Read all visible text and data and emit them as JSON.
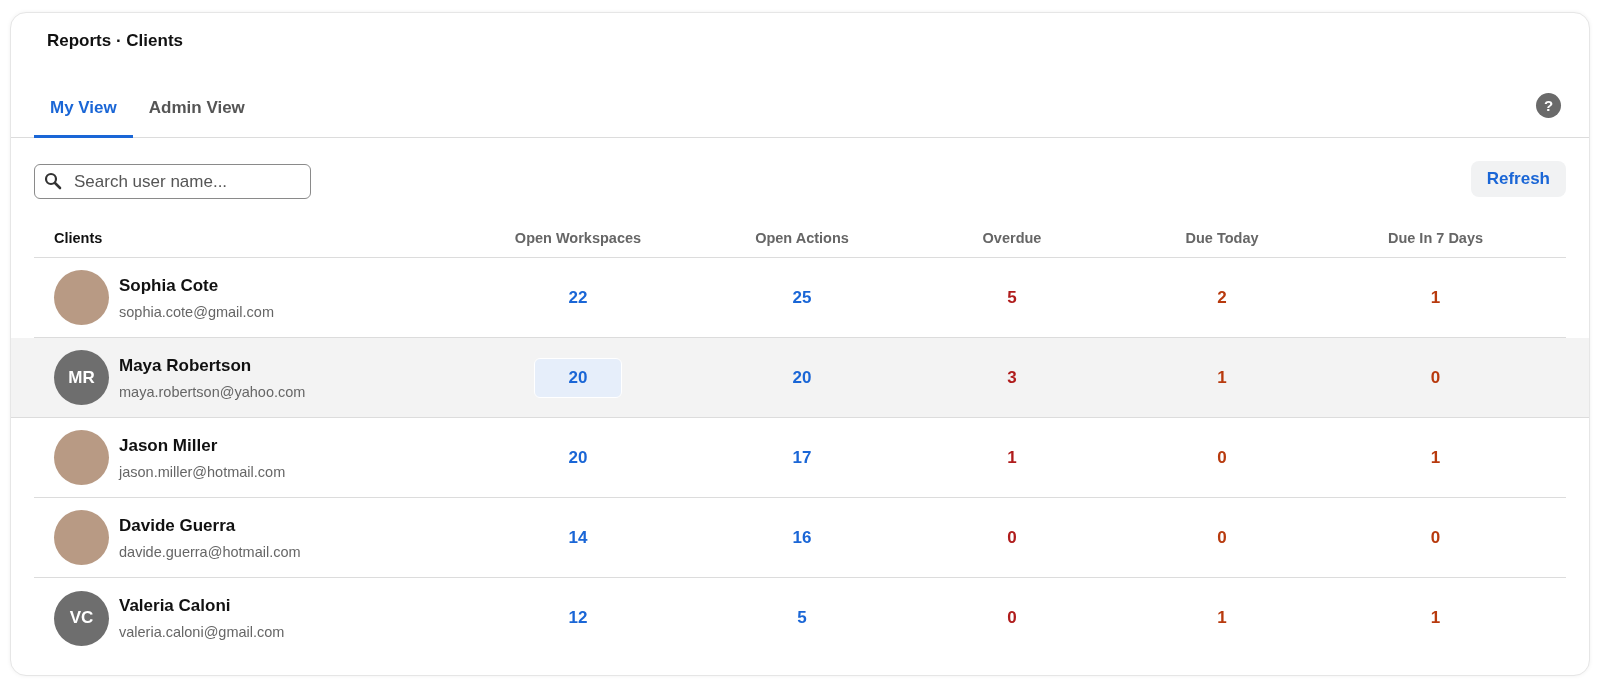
{
  "breadcrumb": "Reports · Clients",
  "tabs": [
    {
      "label": "My View",
      "selected": true
    },
    {
      "label": "Admin View",
      "selected": false
    }
  ],
  "help_icon": "?",
  "search": {
    "placeholder": "Search user name..."
  },
  "refresh_button": "Refresh",
  "table": {
    "client_header": "Clients",
    "columns": [
      {
        "label": "Open Workspaces",
        "kind": "count"
      },
      {
        "label": "Open Actions",
        "kind": "count"
      },
      {
        "label": "Overdue",
        "kind": "overdue"
      },
      {
        "label": "Due Today",
        "kind": "due"
      },
      {
        "label": "Due In 7 Days",
        "kind": "due"
      }
    ],
    "rows": [
      {
        "name": "Sophia Cote",
        "email": "sophia.cote@gmail.com",
        "avatar": {
          "kind": "photo"
        },
        "selected": false,
        "cells": [
          {
            "value": "22",
            "focused": false
          },
          {
            "value": "25",
            "focused": false
          },
          {
            "value": "5",
            "focused": false
          },
          {
            "value": "2",
            "focused": false
          },
          {
            "value": "1",
            "focused": false
          }
        ]
      },
      {
        "name": "Maya Robertson",
        "email": "maya.robertson@yahoo.com",
        "avatar": {
          "kind": "initials",
          "initials": "MR"
        },
        "selected": true,
        "cells": [
          {
            "value": "20",
            "focused": true
          },
          {
            "value": "20",
            "focused": false
          },
          {
            "value": "3",
            "focused": false
          },
          {
            "value": "1",
            "focused": false
          },
          {
            "value": "0",
            "focused": false
          }
        ]
      },
      {
        "name": "Jason Miller",
        "email": "jason.miller@hotmail.com",
        "avatar": {
          "kind": "photo"
        },
        "selected": false,
        "cells": [
          {
            "value": "20",
            "focused": false
          },
          {
            "value": "17",
            "focused": false
          },
          {
            "value": "1",
            "focused": false
          },
          {
            "value": "0",
            "focused": false
          },
          {
            "value": "1",
            "focused": false
          }
        ]
      },
      {
        "name": "Davide Guerra",
        "email": "davide.guerra@hotmail.com",
        "avatar": {
          "kind": "photo"
        },
        "selected": false,
        "cells": [
          {
            "value": "14",
            "focused": false
          },
          {
            "value": "16",
            "focused": false
          },
          {
            "value": "0",
            "focused": false
          },
          {
            "value": "0",
            "focused": false
          },
          {
            "value": "0",
            "focused": false
          }
        ]
      },
      {
        "name": "Valeria Caloni",
        "email": "valeria.caloni@gmail.com",
        "avatar": {
          "kind": "initials",
          "initials": "VC"
        },
        "selected": false,
        "cells": [
          {
            "value": "12",
            "focused": false
          },
          {
            "value": "5",
            "focused": false
          },
          {
            "value": "0",
            "focused": false
          },
          {
            "value": "1",
            "focused": false
          },
          {
            "value": "1",
            "focused": false
          }
        ]
      }
    ]
  }
}
